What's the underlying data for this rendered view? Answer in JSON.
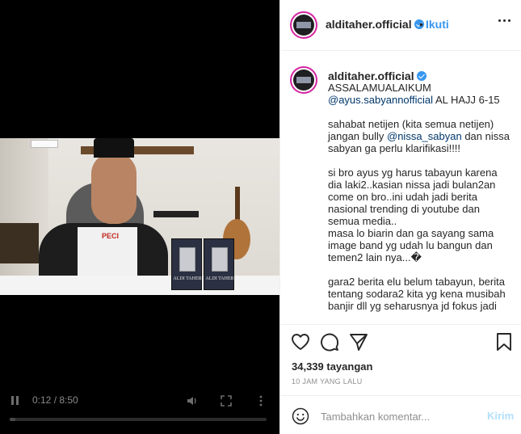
{
  "video": {
    "time_label": "0:12 / 8:50",
    "progress": 0.023,
    "shirt_print": "PECI",
    "box_label": "ALDI TAHER"
  },
  "header": {
    "username": "alditaher.official",
    "separator": "•",
    "follow_label": "Ikuti"
  },
  "caption": {
    "username": "alditaher.official",
    "line1": "ASSALAMUALAIKUM",
    "mention1": "@ayus.sabyannofficial",
    "line2": " AL HAJJ 6-15",
    "para1_a": "sahabat netijen (kita semua netijen) jangan bully ",
    "mention2": "@nissa_sabyan",
    "para1_b": " dan nissa sabyan ga perlu klarifikasi!!!!",
    "para2": "si bro ayus yg harus tabayun karena dia laki2..kasian nissa jadi bulan2an\ncome on bro..ini udah jadi berita nasional trending di youtube dan semua media..\nmasa lo biarin dan ga sayang sama image band yg udah lu bangun dan temen2 lain nya...�",
    "para3": "gara2 berita elu belum tabayun, berita tentang sodara2 kita yg kena musibah banjir dll yg seharusnya jd fokus jadi"
  },
  "stats": {
    "views": "34,339 tayangan",
    "time_ago": "10 JAM YANG LALU"
  },
  "comment": {
    "placeholder": "Tambahkan komentar...",
    "send_label": "Kirim"
  },
  "colors": {
    "accent": "#3897f0",
    "send_disabled": "#b2dffc",
    "mention": "#00376b",
    "ring": "#d6249f"
  },
  "icons": {
    "like": "heart-icon",
    "comment": "comment-icon",
    "share": "share-icon",
    "save": "bookmark-icon",
    "emoji": "emoji-icon"
  }
}
